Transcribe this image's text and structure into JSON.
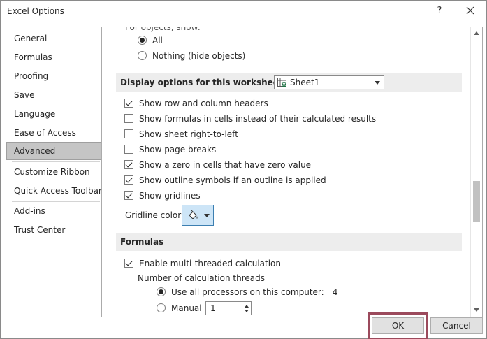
{
  "window": {
    "title": "Excel Options",
    "help_label": "?",
    "close_icon": "close-icon"
  },
  "nav": {
    "items": [
      {
        "label": "General"
      },
      {
        "label": "Formulas"
      },
      {
        "label": "Proofing"
      },
      {
        "label": "Save"
      },
      {
        "label": "Language"
      },
      {
        "label": "Ease of Access"
      },
      {
        "label": "Advanced",
        "selected": true
      },
      {
        "label": "Customize Ribbon"
      },
      {
        "label": "Quick Access Toolbar"
      },
      {
        "label": "Add-ins"
      },
      {
        "label": "Trust Center"
      }
    ]
  },
  "objects": {
    "partial_label": "For objects, show:",
    "all_label": "All",
    "nothing_label": "Nothing (hide objects)",
    "selected": "All"
  },
  "worksheet_section": {
    "header": "Display options for this worksheet:",
    "sheet_value": "Sheet1",
    "options": [
      {
        "label": "Show row and column headers",
        "checked": true
      },
      {
        "label": "Show formulas in cells instead of their calculated results",
        "checked": false
      },
      {
        "label": "Show sheet right-to-left",
        "checked": false
      },
      {
        "label": "Show page breaks",
        "checked": false
      },
      {
        "label": "Show a zero in cells that have zero value",
        "checked": true
      },
      {
        "label": "Show outline symbols if an outline is applied",
        "checked": true
      },
      {
        "label": "Show gridlines",
        "checked": true
      }
    ],
    "gridline_color_label": "Gridline color"
  },
  "formulas_section": {
    "header": "Formulas",
    "multithread_label": "Enable multi-threaded calculation",
    "multithread_checked": true,
    "threads_label": "Number of calculation threads",
    "all_processors_label": "Use all processors on this computer:",
    "processor_count": "4",
    "manual_label": "Manual",
    "manual_value": "1"
  },
  "footer": {
    "ok_label": "OK",
    "cancel_label": "Cancel"
  },
  "colors": {
    "highlight_border": "#9b4a5c",
    "selected_nav": "#c5c5c5",
    "section_header_bg": "#ededed"
  }
}
